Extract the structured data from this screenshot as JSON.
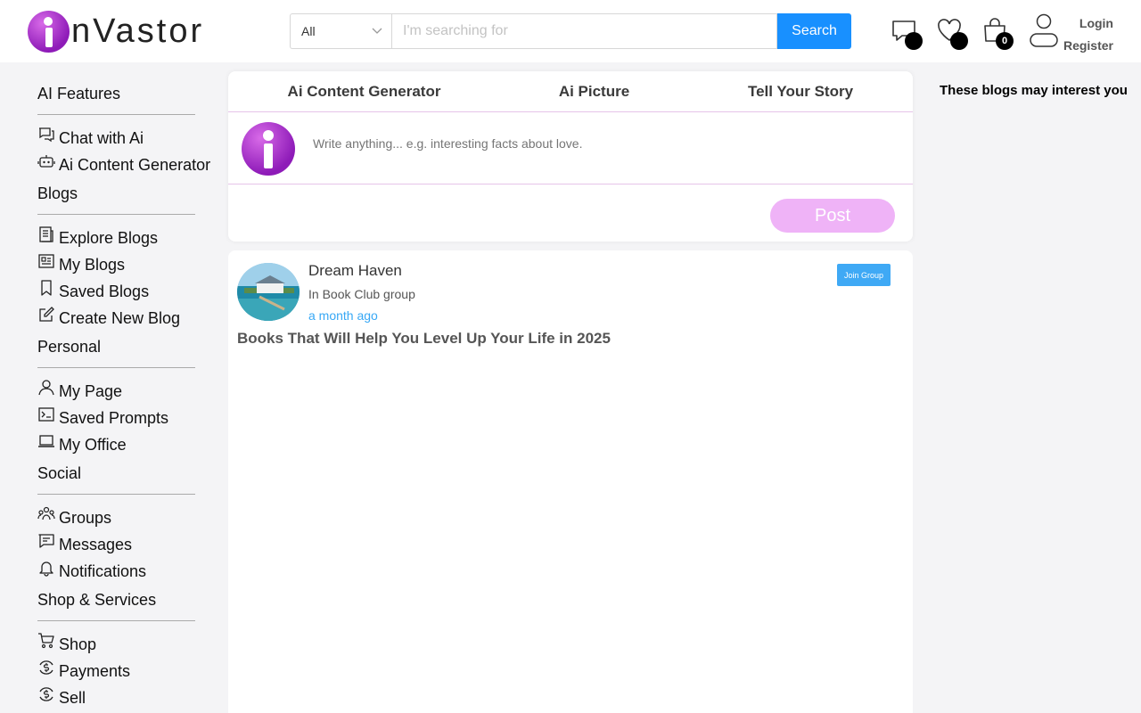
{
  "brand": {
    "logo_text": "nVastor"
  },
  "search": {
    "category": "All",
    "placeholder": "I'm searching for",
    "button_label": "Search"
  },
  "header_icons": {
    "messages_icon": "chat-bubble-icon",
    "wishlist_icon": "heart-icon",
    "cart_icon": "shopping-bag-icon",
    "cart_count": "0"
  },
  "account": {
    "login_label": "Login",
    "register_label": "Register"
  },
  "sidebar": {
    "sections": [
      {
        "title": "AI Features",
        "items": [
          {
            "label": "Chat with Ai",
            "icon": "chat-icon"
          },
          {
            "label": "Ai Content Generator",
            "icon": "robot-icon"
          }
        ]
      },
      {
        "title": "Blogs",
        "items": [
          {
            "label": "Explore Blogs",
            "icon": "newspaper-icon"
          },
          {
            "label": "My Blogs",
            "icon": "article-icon"
          },
          {
            "label": "Saved Blogs",
            "icon": "bookmark-icon"
          },
          {
            "label": "Create New Blog",
            "icon": "edit-icon"
          }
        ]
      },
      {
        "title": "Personal",
        "items": [
          {
            "label": "My Page",
            "icon": "user-icon"
          },
          {
            "label": "Saved Prompts",
            "icon": "terminal-icon"
          },
          {
            "label": "My Office",
            "icon": "laptop-icon"
          }
        ]
      },
      {
        "title": "Social",
        "items": [
          {
            "label": "Groups",
            "icon": "group-icon"
          },
          {
            "label": "Messages",
            "icon": "message-icon"
          },
          {
            "label": "Notifications",
            "icon": "bell-icon"
          }
        ]
      },
      {
        "title": "Shop & Services",
        "items": [
          {
            "label": "Shop",
            "icon": "cart-icon"
          },
          {
            "label": "Payments",
            "icon": "dollar-cycle-icon"
          },
          {
            "label": "Sell",
            "icon": "dollar-cycle-icon"
          }
        ]
      }
    ]
  },
  "composer": {
    "tabs": [
      "Ai Content Generator",
      "Ai Picture",
      "Tell Your Story"
    ],
    "placeholder": "Write anything... e.g. interesting facts about love.",
    "post_label": "Post"
  },
  "feed": {
    "posts": [
      {
        "author": "Dream Haven",
        "group": "In Book Club group",
        "time": "a month ago",
        "join_label": "Join Group",
        "title": "Books That Will Help You Level Up Your Life in 2025"
      }
    ]
  },
  "right_panel": {
    "title": "These blogs may interest you"
  },
  "colors": {
    "accent": "#1890ff",
    "brand_purple": "#9b27c4",
    "post_button": "#efb3f7",
    "link_blue": "#38a8f5"
  }
}
